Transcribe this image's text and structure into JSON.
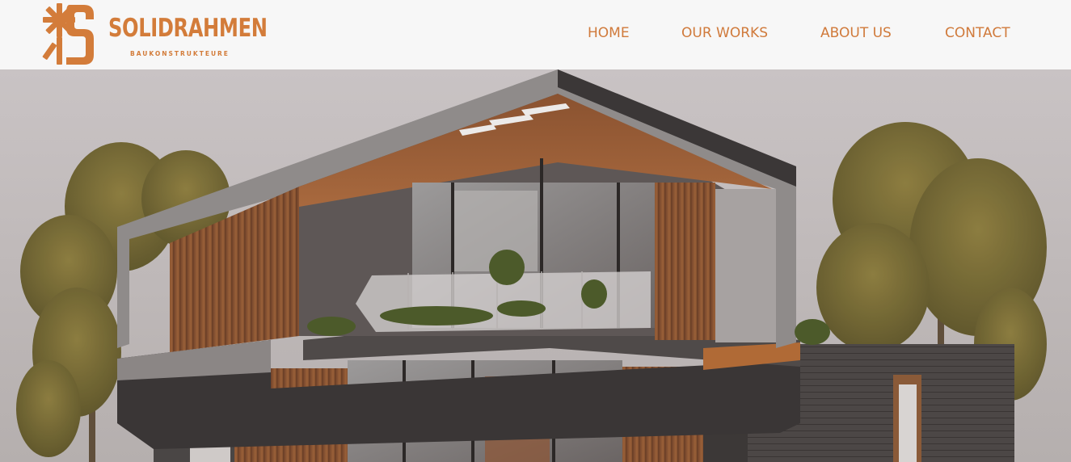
{
  "brand": {
    "name": "SOLIDRAHMEN",
    "tagline": "BAUKONSTRUKTEURE",
    "accent_color": "#d37c3a"
  },
  "nav": {
    "items": [
      {
        "label": "HOME"
      },
      {
        "label": "OUR WORKS"
      },
      {
        "label": "ABOUT US"
      },
      {
        "label": "CONTACT"
      }
    ]
  },
  "hero": {
    "image": "modern-house-illustration",
    "icon": "logo-mark-icon"
  }
}
